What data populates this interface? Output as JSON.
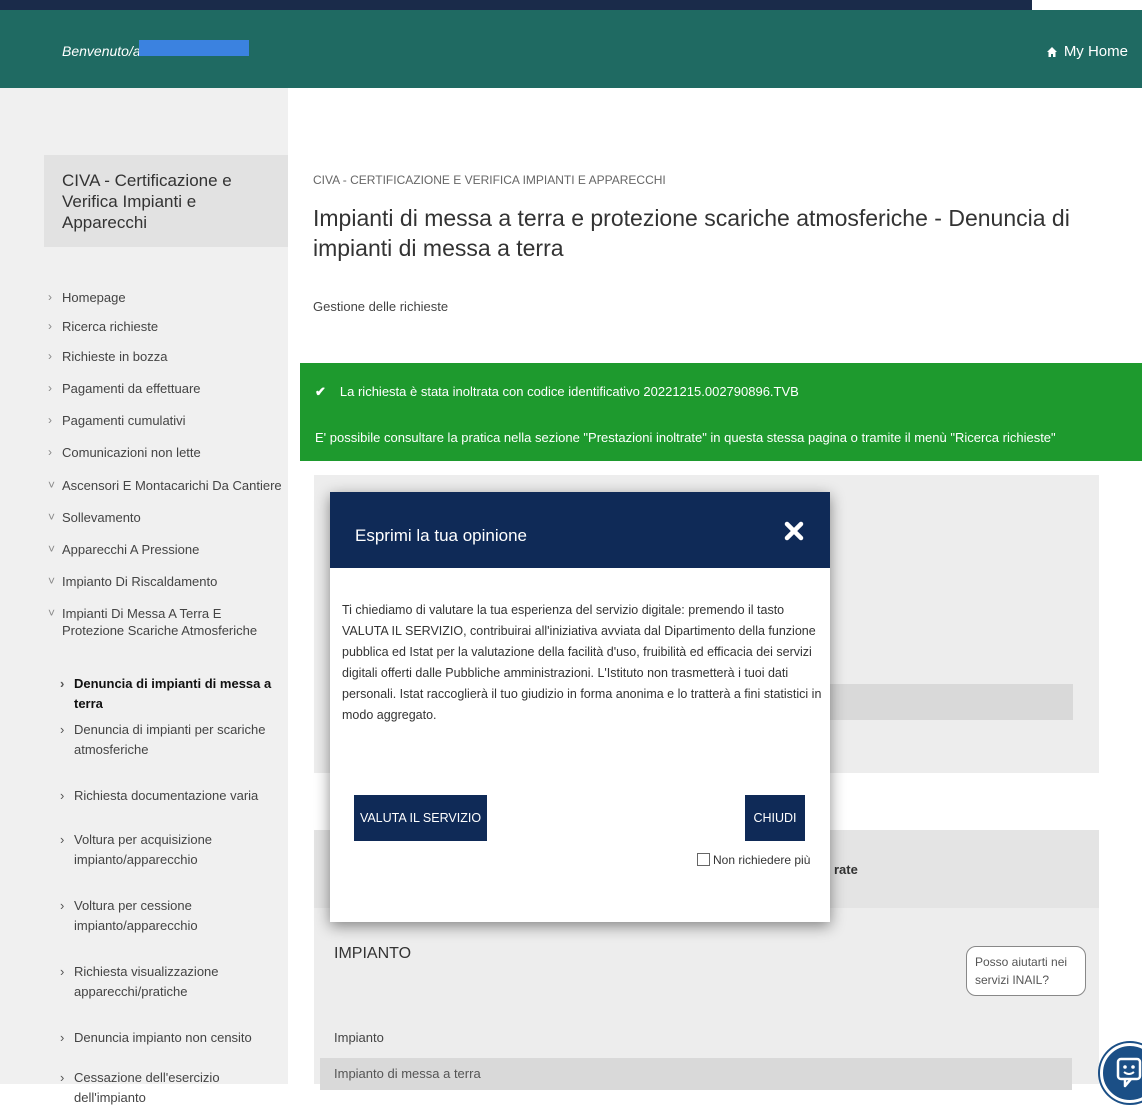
{
  "header": {
    "welcome": "Benvenuto/a",
    "my_home": "My Home"
  },
  "sidebar": {
    "title": "CIVA - Certificazione e Verifica Impianti e Apparecchi",
    "items": [
      {
        "label": "Homepage"
      },
      {
        "label": "Ricerca richieste"
      },
      {
        "label": "Richieste in bozza"
      },
      {
        "label": "Pagamenti da effettuare"
      },
      {
        "label": "Pagamenti cumulativi"
      },
      {
        "label": "Comunicazioni non lette"
      },
      {
        "label": "Ascensori E Montacarichi Da Cantiere"
      },
      {
        "label": "Sollevamento"
      },
      {
        "label": "Apparecchi A Pressione"
      },
      {
        "label": "Impianto Di Riscaldamento"
      },
      {
        "label": "Impianti Di Messa A Terra E Protezione Scariche Atmosferiche"
      }
    ],
    "subitems": [
      {
        "label": "Denuncia di impianti di messa a terra"
      },
      {
        "label": "Denuncia di impianti per scariche atmosferiche"
      },
      {
        "label": "Richiesta documentazione varia"
      },
      {
        "label": "Voltura per acquisizione impianto/apparecchio"
      },
      {
        "label": "Voltura per cessione impianto/apparecchio"
      },
      {
        "label": "Richiesta visualizzazione apparecchi/pratiche"
      },
      {
        "label": "Denuncia impianto non censito"
      },
      {
        "label": "Cessazione dell'esercizio dell'impianto"
      }
    ]
  },
  "main": {
    "breadcrumb": "CIVA - CERTIFICAZIONE E VERIFICA IMPIANTI E APPARECCHI",
    "title": "Impianti di messa a terra e protezione scariche atmosferiche - Denuncia di impianti di messa a terra",
    "subtitle": "Gestione delle richieste",
    "alert": {
      "line1": "La richiesta è stata inoltrata con codice identificativo 20221215.002790896.TVB",
      "line2": "E' possibile consultare la pratica nella sezione \"Prestazioni inoltrate\" in questa stessa pagina o tramite il menù \"Ricerca richieste\""
    },
    "bg_fragment": "rate",
    "impianto": {
      "heading": "IMPIANTO",
      "label": "Impianto",
      "value": "Impianto di messa a terra"
    }
  },
  "modal": {
    "title": "Esprimi la tua opinione",
    "body": "Ti chiediamo di valutare la tua esperienza del servizio digitale: premendo il tasto VALUTA IL SERVIZIO, contribuirai all'iniziativa avviata dal Dipartimento della funzione pubblica ed Istat per la valutazione della facilità d'uso, fruibilità ed efficacia dei servizi digitali offerti dalle Pubbliche amministrazioni. L'Istituto non trasmetterà i tuoi dati personali. Istat raccoglierà il tuo giudizio in forma anonima e lo tratterà a fini statistici in modo aggregato.",
    "valuta_label": "VALUTA IL SERVIZIO",
    "chiudi_label": "CHIUDI",
    "non_richiedere": "Non richiedere più"
  },
  "chat": {
    "bubble": "Posso aiutarti nei servizi INAIL?"
  },
  "colors": {
    "header": "#1f6a62",
    "topstrip": "#1a2b4a",
    "alert": "#1e9a2e",
    "modal_header": "#0f2a57",
    "chat": "#1b4f86",
    "redaction": "#3b82e0"
  }
}
